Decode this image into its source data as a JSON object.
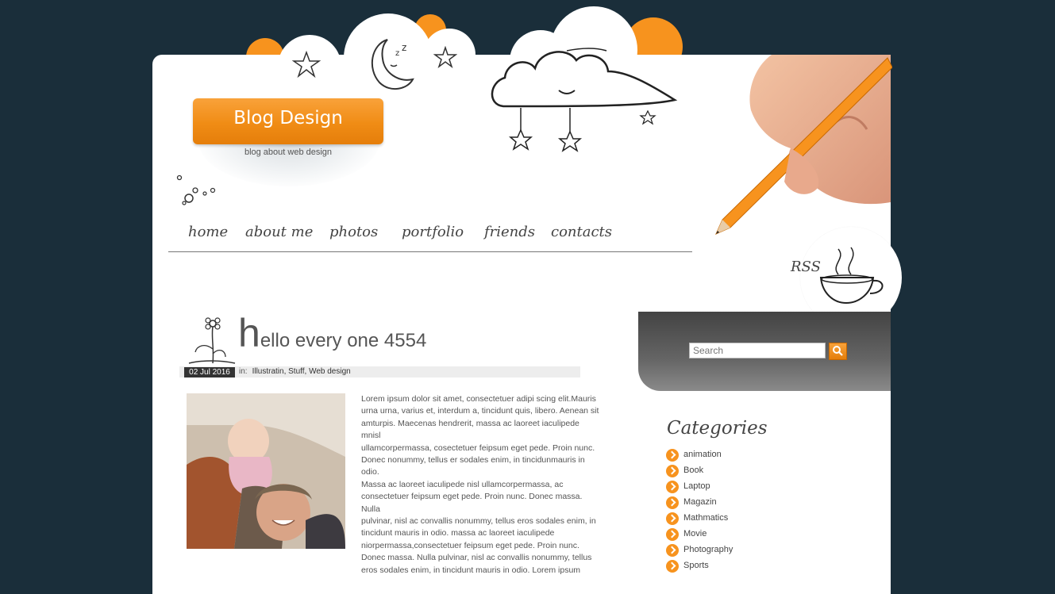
{
  "blog": {
    "title": "Blog Design",
    "tagline": "blog about web design"
  },
  "nav": {
    "items": [
      "home",
      "about me",
      "photos",
      "portfolio",
      "friends",
      "contacts"
    ]
  },
  "rss": {
    "label": "RSS"
  },
  "post": {
    "title_first": "h",
    "title_rest": "ello every one 4554",
    "date": "02 Jul 2016",
    "in_label": "in:",
    "categories": "Illustratin, Stuff, Web design",
    "body": "Lorem ipsum dolor sit amet, consectetuer adipi scing elit.Mauris\nurna urna, varius et, interdum a, tincidunt quis, libero. Aenean sit\namturpis. Maecenas hendrerit, massa ac laoreet iaculipede mnisl\nullamcorpermassa, cosectetuer feipsum eget pede. Proin nunc.\nDonec nonummy, tellus er sodales enim, in tincidunmauris in odio.\nMassa ac laoreet iaculipede nisl ullamcorpermassa, ac\nconsectetuer feipsum eget pede. Proin nunc. Donec massa. Nulla\npulvinar, nisl ac convallis nonummy, tellus eros sodales enim, in\ntincidunt mauris in odio. massa ac laoreet iaculipede\nniorpermassa,consectetuer feipsum eget pede. Proin nunc.\nDonec massa. Nulla pulvinar, nisl ac convallis nonummy, tellus\neros sodales enim, in tincidunt mauris in odio. Lorem ipsum dolor\nsit amet, consectetuer adipi scing elit.Mauris urna urna, varius et,\ninterdum a, tincidunt quis, libero. Aenean sit amturpis.Lorem\nipsum dolor sit amet, consectetuer adipi scing elit.Mauris urna\nurna, varius et, interdum a, tincidunt quis, libero. Aenean sit"
  },
  "search": {
    "placeholder": "Search"
  },
  "categories": {
    "title": "Categories",
    "items": [
      "animation",
      "Book",
      "Laptop",
      "Magazin",
      "Mathmatics",
      "Movie",
      "Photography",
      "Sports"
    ]
  },
  "colors": {
    "background": "#1a2e3a",
    "accent": "#f7931e"
  },
  "icons": [
    "moon-icon",
    "star-icon",
    "cloud-sketch-icon",
    "pencil-hand-icon",
    "coffee-cup-icon",
    "flower-icon",
    "search-icon",
    "arrow-bullet-icon"
  ]
}
